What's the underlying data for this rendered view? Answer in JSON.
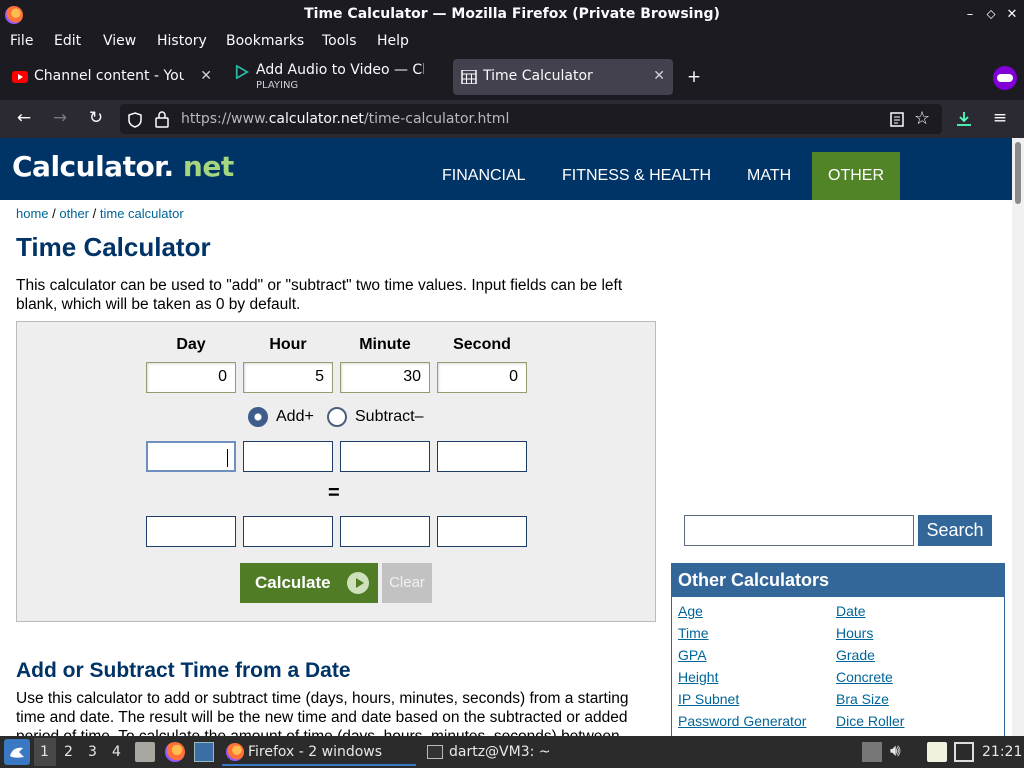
{
  "window": {
    "title": "Time Calculator — Mozilla Firefox (Private Browsing)",
    "min": "–",
    "max": "⬦",
    "close": "✕"
  },
  "menu": [
    "File",
    "Edit",
    "View",
    "History",
    "Bookmarks",
    "Tools",
    "Help"
  ],
  "tabs": [
    {
      "label": "Channel content - YouTub",
      "sub": "",
      "icon": "youtube-icon"
    },
    {
      "label": "Add Audio to Video — Cli",
      "sub": "PLAYING",
      "icon": "play-icon"
    },
    {
      "label": "Time Calculator",
      "sub": "",
      "icon": "calculator-icon"
    }
  ],
  "new_tab": "+",
  "url": {
    "prefix": "https://www.",
    "domain": "calculator.net",
    "path": "/time-calculator.html"
  },
  "site": {
    "logo_main": "Calculator",
    "logo_dot": ".",
    "logo_net": "net",
    "nav": [
      "FINANCIAL",
      "FITNESS & HEALTH",
      "MATH",
      "OTHER"
    ],
    "breadcrumb": {
      "home": "home",
      "sep": " / ",
      "other": "other",
      "current": "time calculator"
    },
    "title": "Time Calculator",
    "intro": "This calculator can be used to \"add\" or \"subtract\" two time values. Input fields can be left blank, which will be taken as 0 by default."
  },
  "calc": {
    "headers": [
      "Day",
      "Hour",
      "Minute",
      "Second"
    ],
    "row1": [
      "0",
      "5",
      "30",
      "0"
    ],
    "row2": [
      "",
      "",
      "",
      ""
    ],
    "result": [
      "",
      "",
      "",
      ""
    ],
    "add_label": "Add+",
    "subtract_label": "Subtract–",
    "operation": "add",
    "equals": "=",
    "calculate_label": "Calculate",
    "clear_label": "Clear"
  },
  "section2": {
    "title": "Add or Subtract Time from a Date",
    "text": "Use this calculator to add or subtract time (days, hours, minutes, seconds) from a starting time and date. The result will be the new time and date based on the subtracted or added period of time. To calculate the amount of time (days, hours, minutes, seconds) between"
  },
  "sidebar": {
    "search_label": "Search",
    "other_title": "Other Calculators",
    "links_left": [
      "Age",
      "Time",
      "GPA",
      "Height",
      "IP Subnet",
      "Password Generator"
    ],
    "links_right": [
      "Date",
      "Hours",
      "Grade",
      "Concrete",
      "Bra Size",
      "Dice Roller"
    ]
  },
  "taskbar": {
    "workspaces": [
      "1",
      "2",
      "3",
      "4"
    ],
    "tasks": [
      "Firefox - 2 windows",
      "dartz@VM3: ~"
    ],
    "clock": "21:21"
  },
  "colors": {
    "brand_blue": "#003366",
    "active_green": "#518427",
    "link": "#006699"
  }
}
